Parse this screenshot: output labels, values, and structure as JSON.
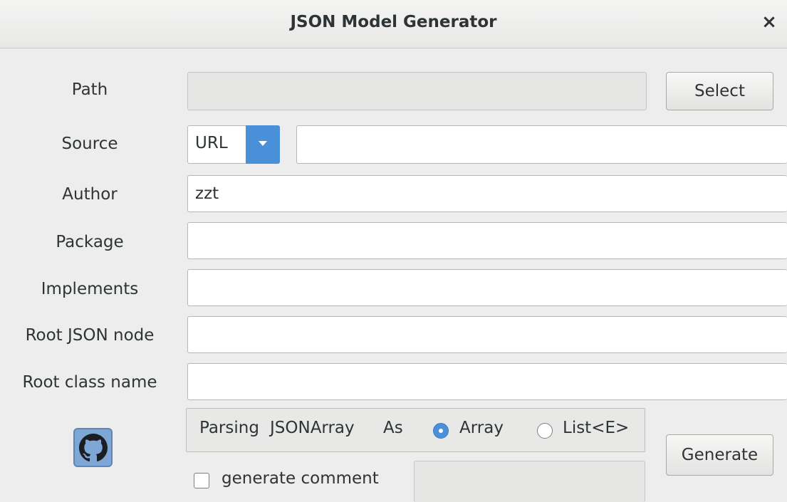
{
  "window": {
    "title": "JSON Model Generator",
    "close_glyph": "×"
  },
  "form": {
    "path": {
      "label": "Path",
      "value": "",
      "button": "Select"
    },
    "source": {
      "label": "Source",
      "type": "URL",
      "value": ""
    },
    "author": {
      "label": "Author",
      "value": "zzt"
    },
    "package": {
      "label": "Package",
      "value": ""
    },
    "implements": {
      "label": "Implements",
      "value": ""
    },
    "root_json_node": {
      "label": "Root JSON node",
      "value": ""
    },
    "root_class_name": {
      "label": "Root class name",
      "value": ""
    }
  },
  "options": {
    "parsing_label": "Parsing",
    "jsonarray_label": "JSONArray",
    "as_label": "As",
    "array_option": "Array",
    "list_option": "List<E>",
    "selected": "Array",
    "generate_comment": "generate comment",
    "generate_comment_checked": false,
    "comment_value": ""
  },
  "actions": {
    "generate": "Generate"
  },
  "icons": {
    "github": "github-icon",
    "dropdown": "chevron-down-icon"
  },
  "colors": {
    "accent": "#4a90d9",
    "background": "#ededed"
  }
}
